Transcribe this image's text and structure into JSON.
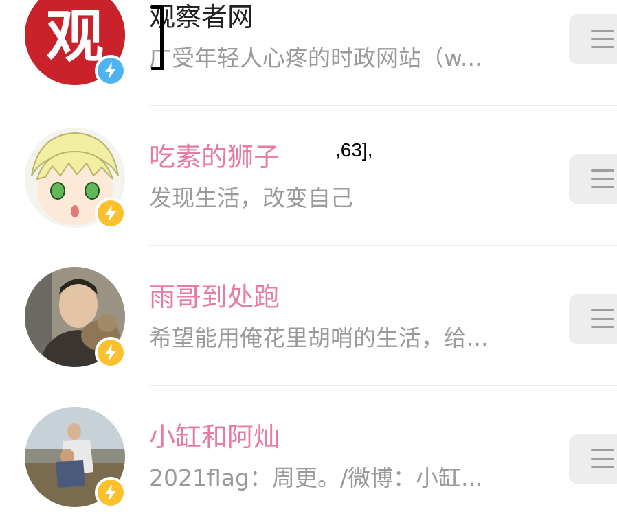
{
  "accounts": [
    {
      "name": "观察者网",
      "name_color": "#222222",
      "description": "广受年轻人心疼的时政网站（w...",
      "avatar_text": "观",
      "badge": "blue"
    },
    {
      "name": "吃素的狮子",
      "name_color": "#e97aa3",
      "description": "发现生活，改变自己",
      "badge": "yellow"
    },
    {
      "name": "雨哥到处跑",
      "name_color": "#e97aa3",
      "description": "希望能用俺花里胡哨的生活，给...",
      "badge": "yellow"
    },
    {
      "name": "小缸和阿灿",
      "name_color": "#e97aa3",
      "description": "2021flag：周更。/微博：小缸...",
      "badge": "yellow"
    }
  ],
  "annotation_text": ",63],",
  "colors": {
    "accent_pink": "#e97aa3",
    "badge_blue": "#4fb3f2",
    "badge_yellow": "#fbc02d",
    "menu_bg": "#ededed"
  },
  "icons": [
    "lightning-icon",
    "menu-icon"
  ]
}
